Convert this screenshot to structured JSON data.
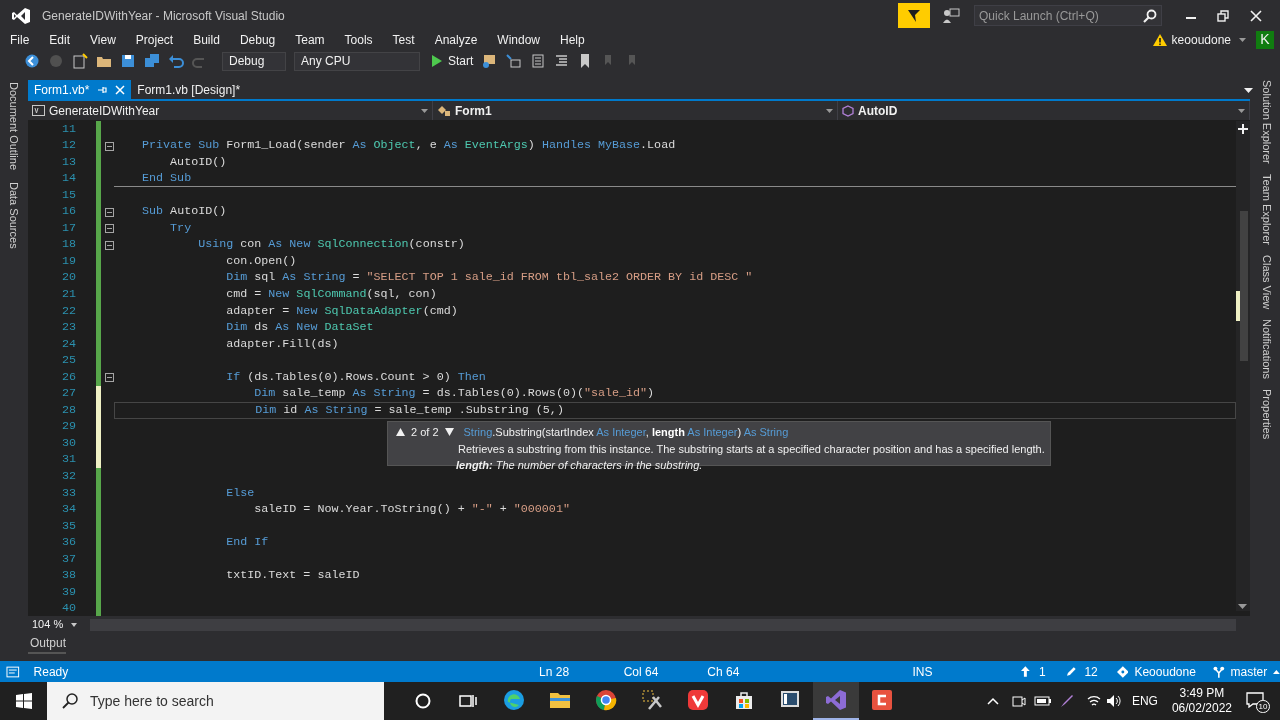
{
  "window": {
    "title": "GenerateIDWithYear - Microsoft Visual Studio"
  },
  "quick_launch": {
    "placeholder": "Quick Launch (Ctrl+Q)"
  },
  "account": {
    "name": "keooudone",
    "initial": "K"
  },
  "menu": [
    "File",
    "Edit",
    "View",
    "Project",
    "Build",
    "Debug",
    "Team",
    "Tools",
    "Test",
    "Analyze",
    "Window",
    "Help"
  ],
  "toolbar": {
    "configuration": "Debug",
    "platform": "Any CPU",
    "start": "Start"
  },
  "left_tabs": [
    "Document Outline",
    "Data Sources"
  ],
  "right_tabs": [
    "Solution Explorer",
    "Team Explorer",
    "Class View",
    "Notifications",
    "Properties"
  ],
  "tabs": [
    {
      "label": "Form1.vb*",
      "selected": true
    },
    {
      "label": "Form1.vb [Design]*",
      "selected": false
    }
  ],
  "nav_bar": {
    "project": "GenerateIDWithYear",
    "class": "Form1",
    "member": "AutoID"
  },
  "code_lines": [
    {
      "number": "11",
      "color": "#57a64a"
    },
    {
      "number": "12",
      "color": "#57a64a",
      "collapsible": true,
      "tokens": [
        {
          "kind": "kw",
          "text": "    Private Sub"
        },
        {
          "kind": "plain",
          "text": " Form1_Load(sender "
        },
        {
          "kind": "kw",
          "text": "As"
        },
        {
          "kind": "type",
          "text": " Object"
        },
        {
          "kind": "plain",
          "text": ", e "
        },
        {
          "kind": "kw",
          "text": "As"
        },
        {
          "kind": "type",
          "text": " EventArgs"
        },
        {
          "kind": "plain",
          "text": ") "
        },
        {
          "kind": "kw",
          "text": "Handles MyBase"
        },
        {
          "kind": "plain",
          "text": ".Load"
        }
      ]
    },
    {
      "number": "13",
      "color": "#57a64a",
      "tokens": [
        {
          "kind": "plain",
          "text": "        AutoID()"
        }
      ]
    },
    {
      "number": "14",
      "color": "#57a64a",
      "separator": true,
      "tokens": [
        {
          "kind": "kw",
          "text": "    End Sub"
        }
      ]
    },
    {
      "number": "15",
      "color": "#57a64a"
    },
    {
      "number": "16",
      "color": "#57a64a",
      "collapsible": true,
      "tokens": [
        {
          "kind": "kw",
          "text": "    Sub"
        },
        {
          "kind": "plain",
          "text": " AutoID()"
        }
      ]
    },
    {
      "number": "17",
      "color": "#57a64a",
      "collapsible": true,
      "tokens": [
        {
          "kind": "kw",
          "text": "        Try"
        }
      ]
    },
    {
      "number": "18",
      "color": "#57a64a",
      "collapsible": true,
      "tokens": [
        {
          "kind": "kw",
          "text": "            Using"
        },
        {
          "kind": "plain",
          "text": " con "
        },
        {
          "kind": "kw",
          "text": "As New"
        },
        {
          "kind": "type",
          "text": " SqlConnection"
        },
        {
          "kind": "plain",
          "text": "(constr)"
        }
      ]
    },
    {
      "number": "19",
      "color": "#57a64a",
      "tokens": [
        {
          "kind": "plain",
          "text": "                con.Open()"
        }
      ]
    },
    {
      "number": "20",
      "color": "#57a64a",
      "tokens": [
        {
          "kind": "kw",
          "text": "                Dim"
        },
        {
          "kind": "plain",
          "text": " sql "
        },
        {
          "kind": "kw",
          "text": "As String"
        },
        {
          "kind": "plain",
          "text": " = "
        },
        {
          "kind": "str",
          "text": "\"SELECT TOP 1 sale_id FROM tbl_sale2 ORDER BY id DESC \""
        }
      ]
    },
    {
      "number": "21",
      "color": "#57a64a",
      "tokens": [
        {
          "kind": "plain",
          "text": "                cmd = "
        },
        {
          "kind": "kw",
          "text": "New"
        },
        {
          "kind": "type",
          "text": " SqlCommand"
        },
        {
          "kind": "plain",
          "text": "(sql, con)"
        }
      ]
    },
    {
      "number": "22",
      "color": "#57a64a",
      "tokens": [
        {
          "kind": "plain",
          "text": "                adapter = "
        },
        {
          "kind": "kw",
          "text": "New"
        },
        {
          "kind": "type",
          "text": " SqlDataAdapter"
        },
        {
          "kind": "plain",
          "text": "(cmd)"
        }
      ]
    },
    {
      "number": "23",
      "color": "#57a64a",
      "tokens": [
        {
          "kind": "kw",
          "text": "                Dim"
        },
        {
          "kind": "plain",
          "text": " ds "
        },
        {
          "kind": "kw",
          "text": "As New"
        },
        {
          "kind": "type",
          "text": " DataSet"
        }
      ]
    },
    {
      "number": "24",
      "color": "#57a64a",
      "tokens": [
        {
          "kind": "plain",
          "text": "                adapter.Fill(ds)"
        }
      ]
    },
    {
      "number": "25",
      "color": "#57a64a"
    },
    {
      "number": "26",
      "color": "#57a64a",
      "collapsible": true,
      "tokens": [
        {
          "kind": "kw",
          "text": "                If"
        },
        {
          "kind": "plain",
          "text": " (ds.Tables(0).Rows.Count > 0) "
        },
        {
          "kind": "kw",
          "text": "Then"
        }
      ]
    },
    {
      "number": "27",
      "color": "#eff0c4",
      "tokens": [
        {
          "kind": "kw",
          "text": "                    Dim"
        },
        {
          "kind": "plain",
          "text": " sale_temp "
        },
        {
          "kind": "kw",
          "text": "As String"
        },
        {
          "kind": "plain",
          "text": " = ds.Tables(0).Rows(0)("
        },
        {
          "kind": "str",
          "text": "\"sale_id\""
        },
        {
          "kind": "plain",
          "text": ")"
        }
      ]
    },
    {
      "number": "28",
      "color": "#eff0c4",
      "current": true,
      "tokens": [
        {
          "kind": "kw",
          "text": "                    Dim"
        },
        {
          "kind": "plain",
          "text": " id "
        },
        {
          "kind": "kw",
          "text": "As String"
        },
        {
          "kind": "plain",
          "text": " = sale_temp .Substring (5,)"
        }
      ]
    },
    {
      "number": "29",
      "color": "#eff0c4"
    },
    {
      "number": "30",
      "color": "#eff0c4"
    },
    {
      "number": "31",
      "color": "#eff0c4"
    },
    {
      "number": "32",
      "color": "#57a64a"
    },
    {
      "number": "33",
      "color": "#57a64a",
      "tokens": [
        {
          "kind": "kw",
          "text": "                Else"
        }
      ]
    },
    {
      "number": "34",
      "color": "#57a64a",
      "tokens": [
        {
          "kind": "plain",
          "text": "                    saleID = Now.Year.ToString() + "
        },
        {
          "kind": "str",
          "text": "\"-\""
        },
        {
          "kind": "plain",
          "text": " + "
        },
        {
          "kind": "str",
          "text": "\"000001\""
        }
      ]
    },
    {
      "number": "35",
      "color": "#57a64a"
    },
    {
      "number": "36",
      "color": "#57a64a",
      "tokens": [
        {
          "kind": "kw",
          "text": "                End If"
        }
      ]
    },
    {
      "number": "37",
      "color": "#57a64a"
    },
    {
      "number": "38",
      "color": "#57a64a",
      "tokens": [
        {
          "kind": "plain",
          "text": "                txtID.Text = saleID"
        }
      ]
    },
    {
      "number": "39",
      "color": "#57a64a"
    },
    {
      "number": "40",
      "color": "#57a64a"
    }
  ],
  "tooltip": {
    "counter": "2 of 2",
    "signature": [
      {
        "kind": "kw",
        "text": "String"
      },
      {
        "kind": "plain",
        "text": ".Substring(startIndex "
      },
      {
        "kind": "kw",
        "text": "As Integer"
      },
      {
        "kind": "plain",
        "text": ", "
      },
      {
        "kind": "bold",
        "text": "length"
      },
      {
        "kind": "kw",
        "text": " As Integer"
      },
      {
        "kind": "plain",
        "text": ") "
      },
      {
        "kind": "kw",
        "text": "As String"
      }
    ],
    "description": "Retrieves a substring from this instance. The substring starts at a specified character position and has a specified length.",
    "parameter": "**length:** The number of characters in the substring."
  },
  "zoom": "104 %",
  "output_tab": "Output",
  "status_bar": {
    "state": "Ready",
    "line": "Ln 28",
    "col": "Col 64",
    "ch": "Ch 64",
    "mode": "INS",
    "up": "1",
    "edits": "12",
    "repo": "Keooudone",
    "branch": "master"
  },
  "taskbar": {
    "search_placeholder": "Type here to search",
    "apps": [
      {
        "kind": "edge",
        "active": false
      },
      {
        "kind": "folder",
        "active": false
      },
      {
        "kind": "chrome",
        "active": false
      },
      {
        "kind": "tools",
        "active": false
      },
      {
        "kind": "vivaldi",
        "active": false
      },
      {
        "kind": "store",
        "active": false
      },
      {
        "kind": "screen",
        "active": false
      },
      {
        "kind": "vs",
        "active": true
      },
      {
        "kind": "red",
        "active": false
      }
    ],
    "language": "ENG",
    "time": "3:49 PM",
    "date": "06/02/2022",
    "notifications": "10"
  }
}
